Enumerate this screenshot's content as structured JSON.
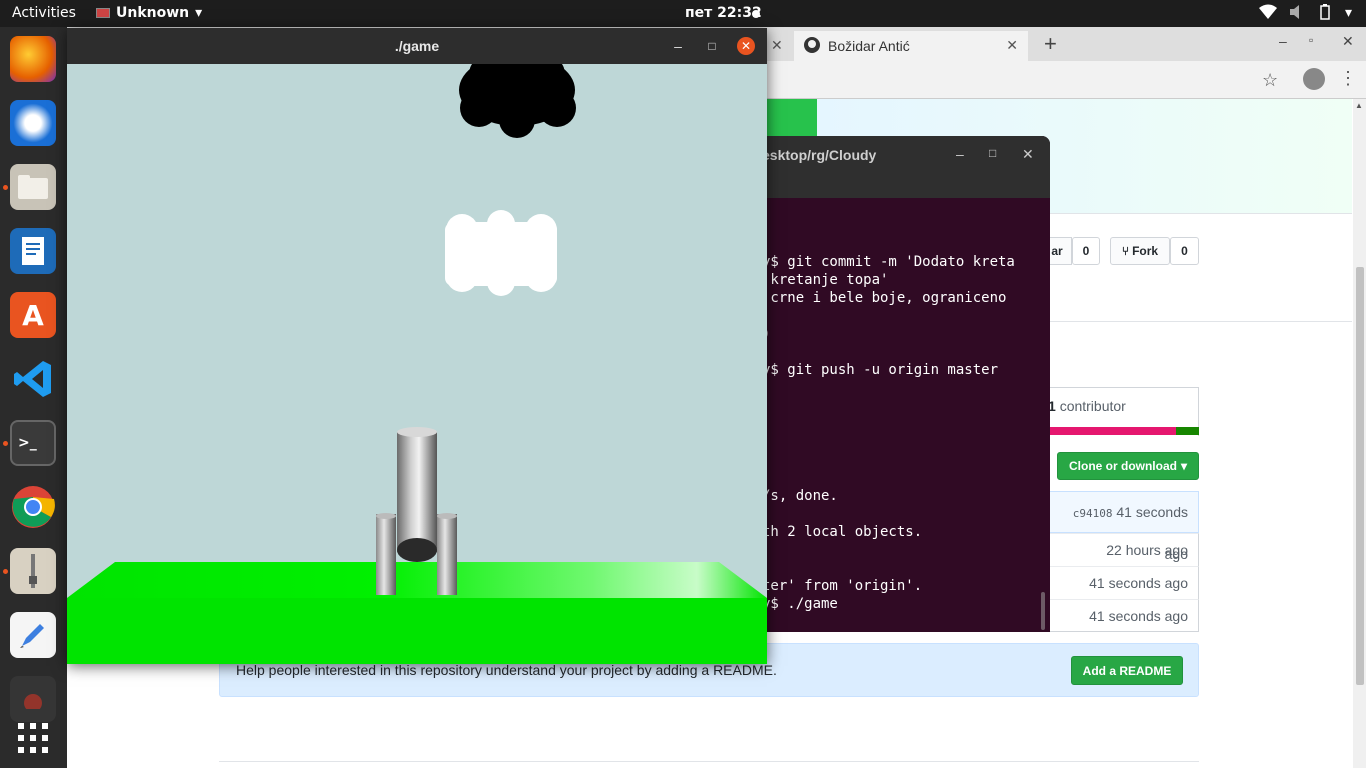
{
  "topbar": {
    "activities": "Activities",
    "app_menu": "Unknown",
    "clock": "пет 22:32"
  },
  "browser": {
    "tab_label": "Božidar Antić",
    "new_tab": "+",
    "star_label": "ar",
    "star_count": "0",
    "fork_label": "Fork",
    "fork_count": "0",
    "contributors_count": "1",
    "contributors_label": "contributor",
    "clone_button": "Clone or download",
    "commit_hash": "c94108",
    "rows": [
      "41 seconds ago",
      "22 hours ago",
      "41 seconds ago",
      "41 seconds ago"
    ],
    "readme_prompt": "Help people interested in this repository understand your project by adding a README.",
    "add_readme": "Add a README"
  },
  "terminal": {
    "title": "esktop/rg/Cloudy",
    "lines": [
      "y$ git commit -m 'Dodato kreta",
      " kretanje topa'",
      " crne i bele boje, ograniceno",
      ")",
      "y$ git push -u origin master",
      "/s, done.",
      "th 2 local objects.",
      "ter' from 'origin'.",
      "y$ ./game"
    ]
  },
  "game": {
    "title": "./game"
  },
  "colors": {
    "ubuntu_orange": "#e95420",
    "terminal_bg": "#300a24",
    "github_green": "#28a745",
    "sky": "#bed7d7",
    "ground": "#00e400"
  }
}
